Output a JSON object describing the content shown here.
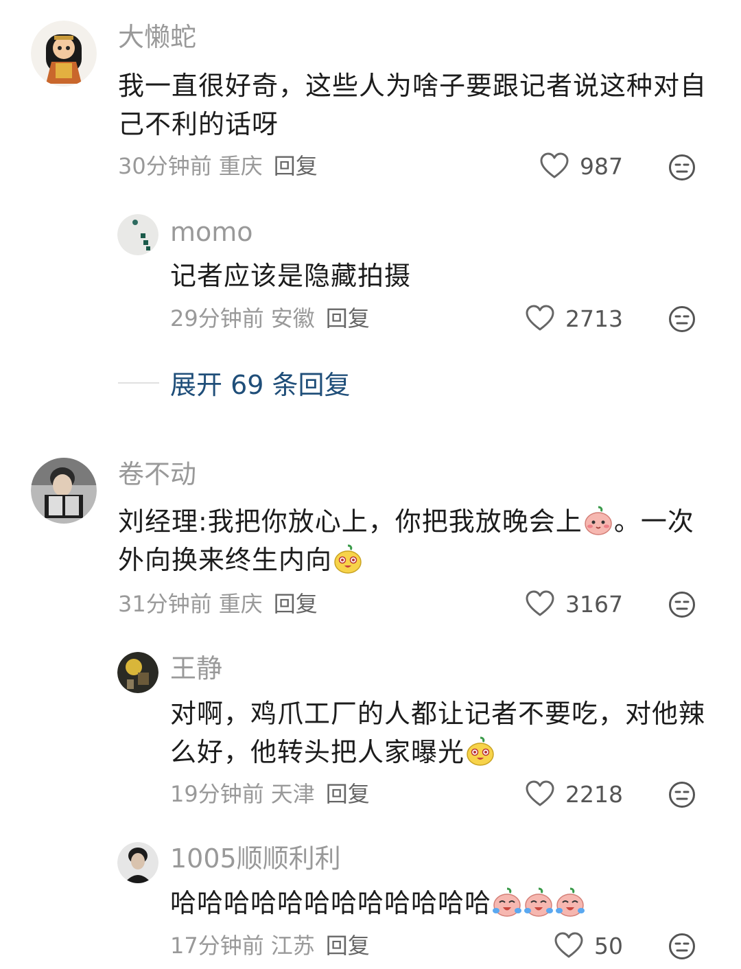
{
  "comments": [
    {
      "username": "大懒蛇",
      "text": "我一直很好奇，这些人为啥子要跟记者说这种对自己不利的话呀",
      "time": "30分钟前",
      "location": "重庆",
      "reply_label": "回复",
      "likes": "987",
      "replies": [
        {
          "username": "momo",
          "text": "记者应该是隐藏拍摄",
          "time": "29分钟前",
          "location": "安徽",
          "reply_label": "回复",
          "likes": "2713"
        }
      ],
      "expand_label": "展开 69 条回复"
    },
    {
      "username": "卷不动",
      "text_part1": "刘经理:我把你放心上，你把我放晚会上",
      "text_part2": "。一次外向换来终生内向",
      "time": "31分钟前",
      "location": "重庆",
      "reply_label": "回复",
      "likes": "3167",
      "replies": [
        {
          "username": "王静",
          "text": "对啊，鸡爪工厂的人都让记者不要吃，对他辣么好，他转头把人家曝光",
          "time": "19分钟前",
          "location": "天津",
          "reply_label": "回复",
          "likes": "2218"
        },
        {
          "username": "1005顺顺利利",
          "text": "哈哈哈哈哈哈哈哈哈哈哈哈",
          "time": "17分钟前",
          "location": "江苏",
          "reply_label": "回复",
          "likes": "50"
        }
      ]
    }
  ],
  "icons": {
    "like": "heart-outline-icon",
    "dislike": "meh-face-icon",
    "emoji_shy": "pink-blush-emoji",
    "emoji_grin": "yellow-grin-emoji",
    "emoji_laugh_cry": "pink-laugh-cry-emoji"
  },
  "colors": {
    "username": "#999999",
    "body": "#1c1c1c",
    "meta": "#999999",
    "expand": "#1f4e79"
  }
}
